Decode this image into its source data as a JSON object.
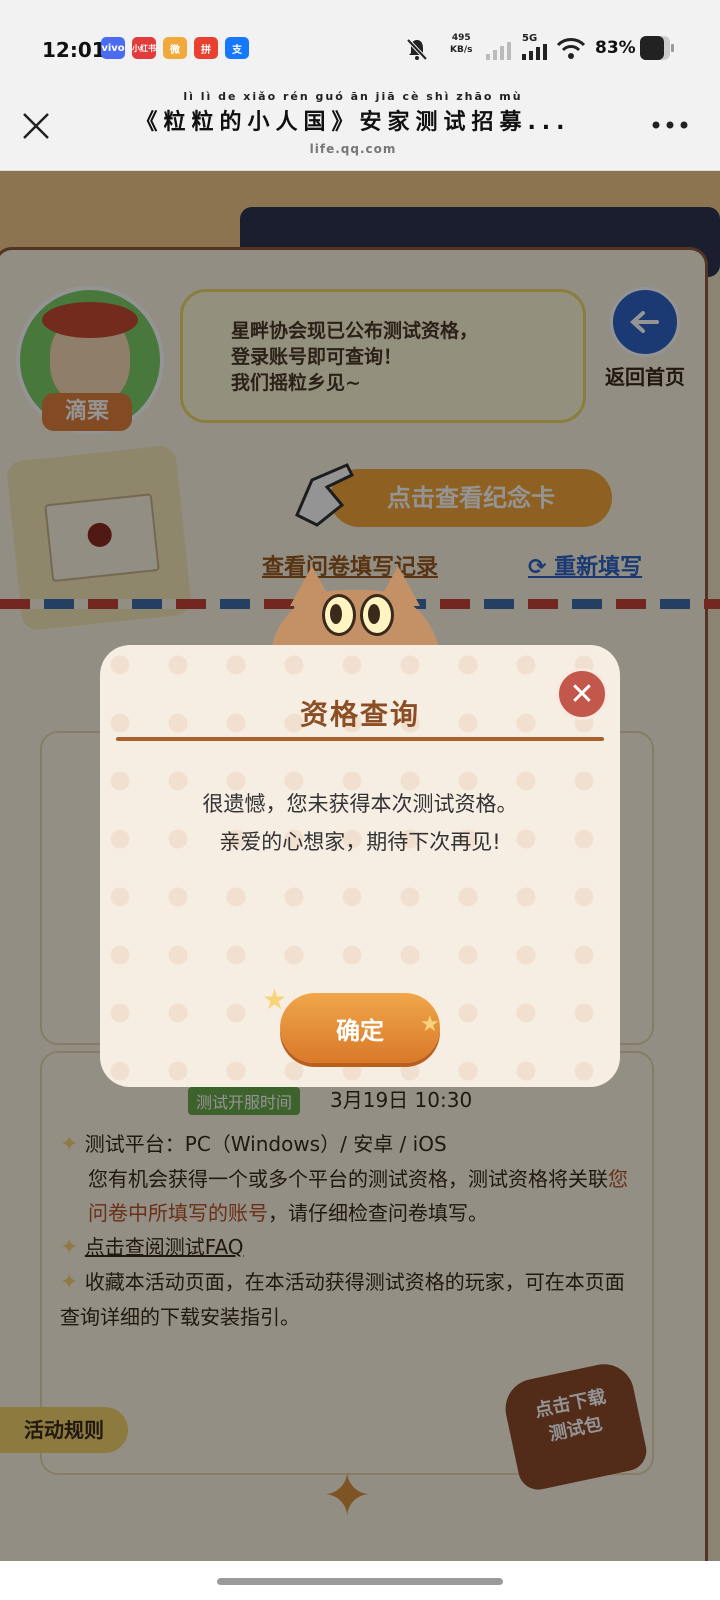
{
  "status_bar": {
    "time": "12:01",
    "apps": [
      {
        "label": "vivo",
        "color": "#4b6cf0"
      },
      {
        "label": "小红书",
        "color": "#e23b3b"
      },
      {
        "label": "微",
        "color": "#f2a93b"
      },
      {
        "label": "拼",
        "color": "#e8412f"
      },
      {
        "label": "支",
        "color": "#1677ff"
      }
    ],
    "net_speed_value": "495",
    "net_speed_unit": "KB/s",
    "network": "5G",
    "battery": "83%"
  },
  "nav": {
    "pinyin": "lì   lì   de  xiǎo rén guó     ān  jiā  cè  shì zhāo mù",
    "title": "《粒粒的小人国》安家测试招募...",
    "url": "life.qq.com"
  },
  "page": {
    "npc_name": "滴栗",
    "bubble_text": [
      "星畔协会现已公布测试资格，",
      "登录账号即可查询！",
      "我们摇粒乡见~"
    ],
    "back_home": "返回首页",
    "view_card_button": "点击查看纪念卡",
    "view_record_link": "查看问卷填写记录",
    "refill_link": "重新填写",
    "server_time_badge": "测试开服时间",
    "server_time": "3月19日  10:30",
    "rules": [
      {
        "text": "测试平台：PC（Windows）/ 安卓 / iOS"
      },
      {
        "text": "您有机会获得一个或多个平台的测试资格，测试资格将关联"
      },
      {
        "text": "您问卷中所填写的账号",
        "highlight": true
      },
      {
        "text": "，请仔细检查问卷填写。"
      },
      {
        "text": "点击查阅测试FAQ",
        "link": true
      },
      {
        "text": "收藏本活动页面，在本活动获得测试资格的玩家，可在本页面查询详细的下载安装指引。"
      }
    ],
    "download_badge": [
      "点击下载",
      "测试包"
    ],
    "activity_rules_tab": "活动规则"
  },
  "modal": {
    "title": "资格查询",
    "message": [
      "很遗憾，您未获得本次测试资格。",
      "亲爱的心想家，期待下次再见!"
    ],
    "confirm": "确定"
  },
  "colors": {
    "modal_title": "#8b4e25",
    "confirm_bg": "#d9792a",
    "close_bg": "#c4574b",
    "highlight_text": "#b5522a"
  }
}
